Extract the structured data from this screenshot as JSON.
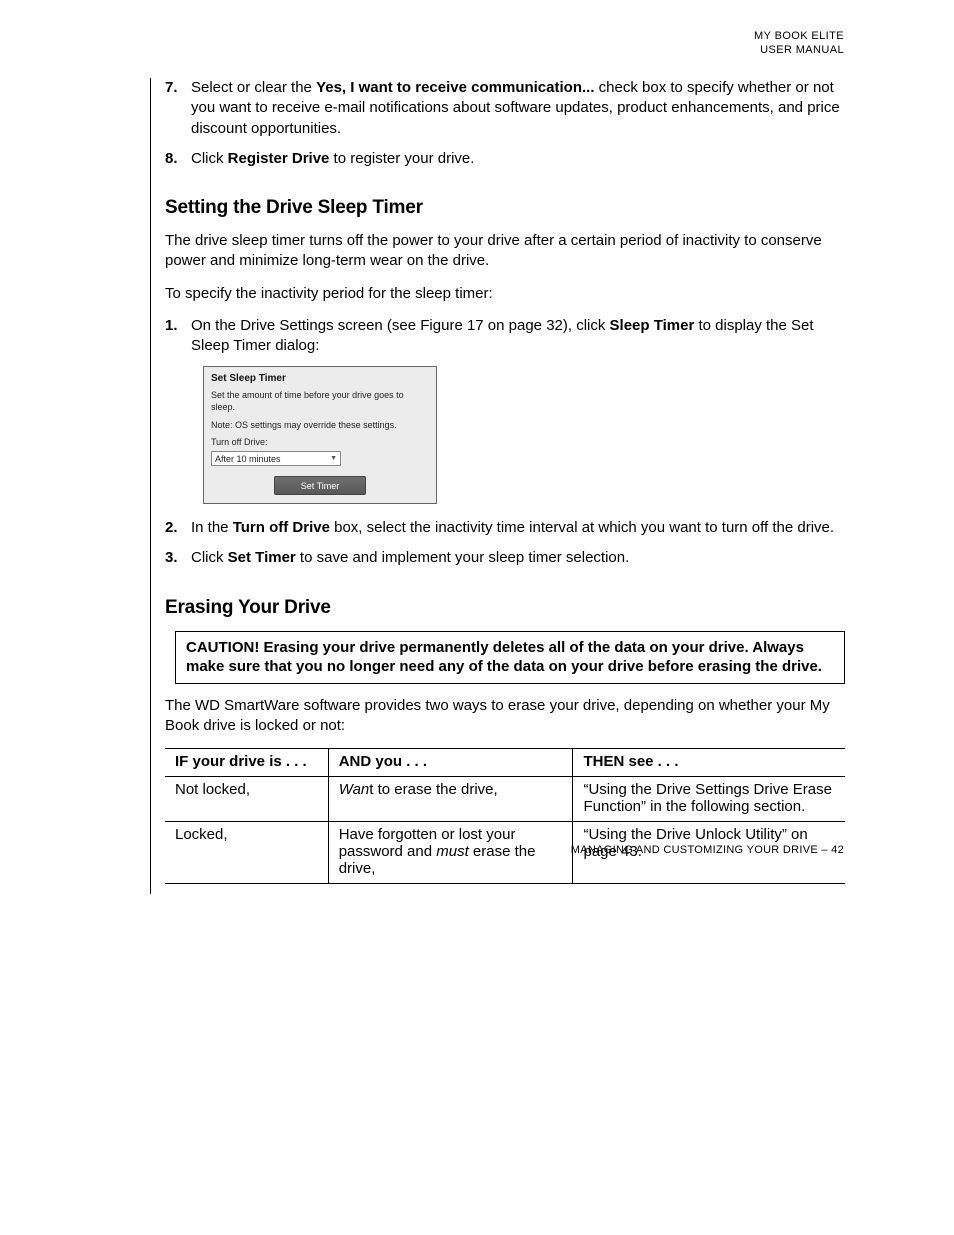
{
  "header": {
    "line1": "MY BOOK ELITE",
    "line2": "USER MANUAL"
  },
  "steps_top": [
    {
      "num": "7.",
      "parts": [
        {
          "t": "Select or clear the "
        },
        {
          "t": "Yes, I want to receive communication...",
          "b": true
        },
        {
          "t": " check box to specify whether or not you want to receive e-mail notifications about software updates, product enhancements, and price discount opportunities."
        }
      ]
    },
    {
      "num": "8.",
      "parts": [
        {
          "t": "Click "
        },
        {
          "t": "Register Drive",
          "b": true
        },
        {
          "t": " to register your drive."
        }
      ]
    }
  ],
  "sleep": {
    "heading": "Setting the Drive Sleep Timer",
    "intro1": "The drive sleep timer turns off the power to your drive after a certain period of inactivity to conserve power and minimize long-term wear on the drive.",
    "intro2": "To specify the inactivity period for the sleep timer:",
    "steps": [
      {
        "num": "1.",
        "parts": [
          {
            "t": "On the Drive Settings screen (see Figure 17 on page 32), click "
          },
          {
            "t": "Sleep Timer",
            "b": true
          },
          {
            "t": " to display the Set Sleep Timer dialog:"
          }
        ]
      },
      {
        "num": "2.",
        "parts": [
          {
            "t": "In the "
          },
          {
            "t": "Turn off Drive",
            "b": true
          },
          {
            "t": " box, select the inactivity time interval at which you want to turn off the drive."
          }
        ]
      },
      {
        "num": "3.",
        "parts": [
          {
            "t": "Click "
          },
          {
            "t": "Set Timer",
            "b": true
          },
          {
            "t": " to save and implement your sleep timer selection."
          }
        ]
      }
    ],
    "dialog": {
      "title": "Set Sleep Timer",
      "line1": "Set the amount of time before your drive goes to sleep.",
      "line2": "Note: OS settings may override these settings.",
      "turn_off_label": "Turn off Drive:",
      "select_value": "After 10 minutes",
      "button": "Set Timer"
    }
  },
  "erase": {
    "heading": "Erasing Your Drive",
    "caution": "CAUTION!  Erasing your drive permanently deletes all of the data on your drive. Always make sure that you no longer need any of the data on your drive before erasing the drive.",
    "intro_parts": [
      {
        "t": "The "
      },
      {
        "t": "WD SmartWare software provides two ways to erase your drive, depending on whether your My Book drive is locked or not:"
      }
    ],
    "table": {
      "headers": [
        "IF your drive is . . .",
        "AND you . . .",
        "THEN see . . ."
      ],
      "rows": [
        {
          "c1": "Not locked,",
          "c2": [
            {
              "t": "Wan",
              "i": true
            },
            {
              "t": "t to erase the drive,"
            }
          ],
          "c3": "“Using the Drive Settings Drive Erase Function” in the following section."
        },
        {
          "c1": "Locked,",
          "c2": [
            {
              "t": "Have forgotten or lost your password and "
            },
            {
              "t": "must",
              "i": true
            },
            {
              "t": " erase the drive,"
            }
          ],
          "c3": "“Using the Drive Unlock Utility” on page 43."
        }
      ]
    }
  },
  "footer": "MANAGING AND CUSTOMIZING YOUR DRIVE – 42"
}
